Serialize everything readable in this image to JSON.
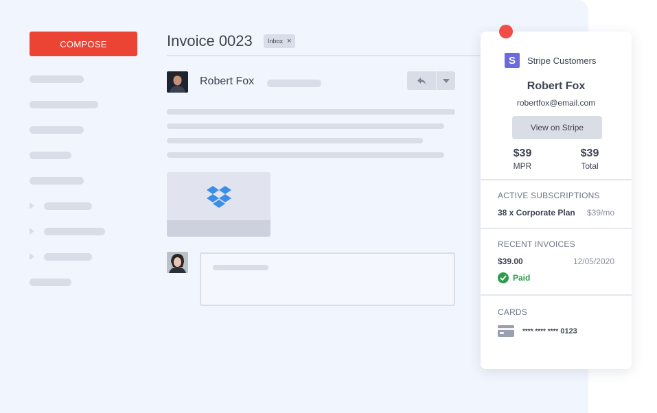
{
  "compose": {
    "label": "COMPOSE"
  },
  "email": {
    "subject": "Invoice 0023",
    "tag": {
      "label": "Inbox",
      "remove": "×"
    },
    "sender": "Robert Fox"
  },
  "icons": {
    "reply": "reply-icon",
    "more": "chevron-down-icon",
    "attachment": "dropbox-icon",
    "stripe": "stripe-logo",
    "paid": "check-circle-icon",
    "card": "credit-card-icon"
  },
  "colors": {
    "compose": "#eb4334",
    "stripe": "#6c6bde",
    "paid": "#2c9b4b",
    "dropbox": "#3d8de8",
    "notification_dot": "#f14c45"
  },
  "panel": {
    "title": "Stripe Customers",
    "logo_letter": "S",
    "customer": {
      "name": "Robert Fox",
      "email": "robertfox@email.com"
    },
    "view_button": "View on Stripe",
    "stats": [
      {
        "value": "$39",
        "label": "MPR"
      },
      {
        "value": "$39",
        "label": "Total"
      }
    ],
    "subscriptions": {
      "heading": "ACTIVE SUBSCRIPTIONS",
      "plan": "38 x Corporate Plan",
      "price": "$39/mo"
    },
    "invoices": {
      "heading": "RECENT INVOICES",
      "amount": "$39.00",
      "date": "12/05/2020",
      "status": "Paid"
    },
    "cards": {
      "heading": "CARDS",
      "mask": "**** **** ****",
      "last4": "0123"
    }
  }
}
